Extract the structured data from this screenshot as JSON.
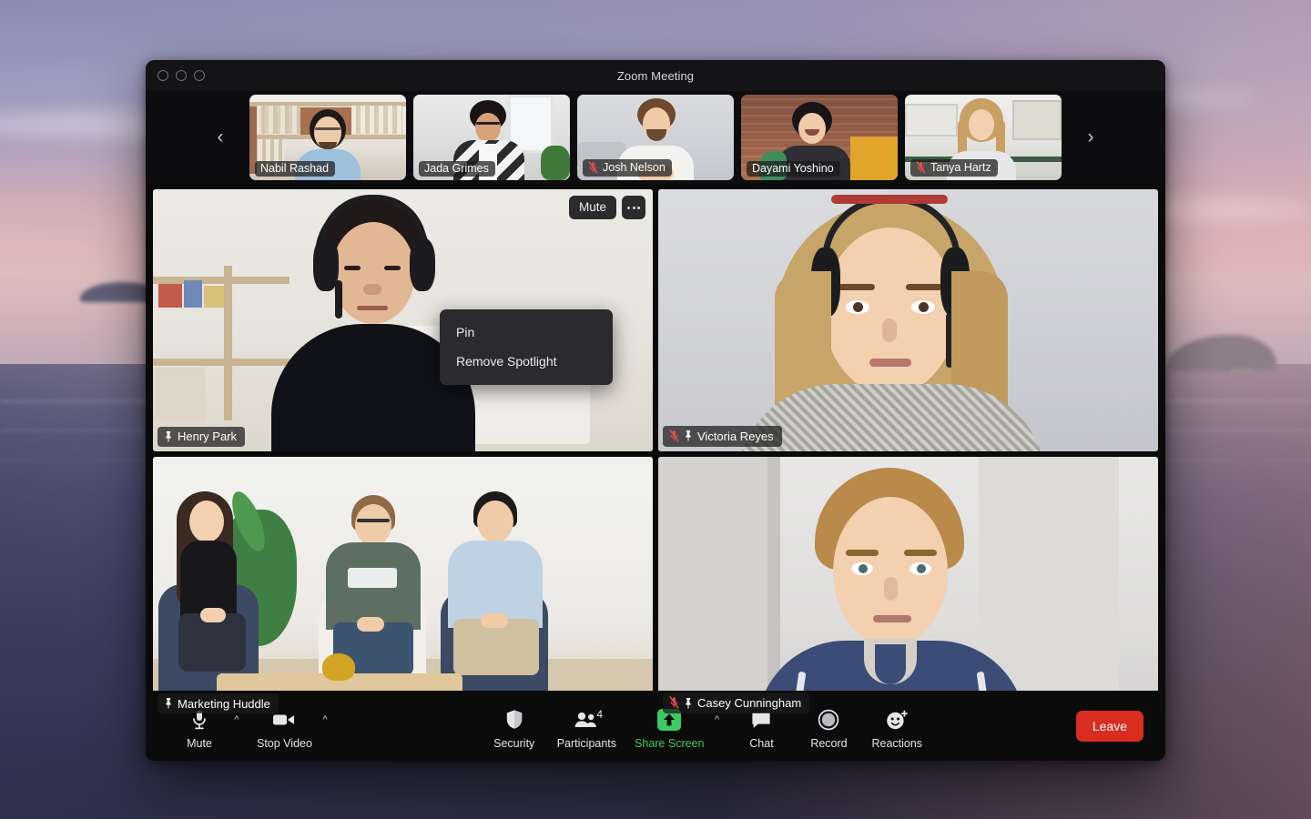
{
  "window": {
    "title": "Zoom Meeting",
    "traffic_lights": [
      "close-button",
      "minimize-button",
      "maximize-button"
    ]
  },
  "filmstrip": {
    "prev_arrow": "‹",
    "next_arrow": "›",
    "participants": [
      {
        "name": "Nabil Rashad",
        "muted": false,
        "scene": "bookshelf"
      },
      {
        "name": "Jada Grimes",
        "muted": false,
        "scene": "window-room"
      },
      {
        "name": "Josh Nelson",
        "muted": true,
        "scene": "plain-room"
      },
      {
        "name": "Dayami Yoshino",
        "muted": false,
        "scene": "brick-room"
      },
      {
        "name": "Tanya Hartz",
        "muted": true,
        "scene": "kitchen"
      }
    ]
  },
  "grid": {
    "tiles": [
      {
        "name": "Henry Park",
        "muted": false,
        "pinned": true,
        "active_speaker": false,
        "scene": "henry",
        "has_controls": true
      },
      {
        "name": "Victoria Reyes",
        "muted": true,
        "pinned": true,
        "active_speaker": false,
        "scene": "victoria",
        "has_controls": false
      },
      {
        "name": "Marketing Huddle",
        "muted": false,
        "pinned": true,
        "active_speaker": true,
        "scene": "huddle",
        "has_controls": false
      },
      {
        "name": "Casey Cunningham",
        "muted": true,
        "pinned": true,
        "active_speaker": false,
        "scene": "casey",
        "has_controls": false
      }
    ]
  },
  "tile_controls": {
    "mute_label": "Mute",
    "more_label": "•••"
  },
  "context_menu": {
    "items": [
      {
        "label": "Pin"
      },
      {
        "label": "Remove Spotlight"
      }
    ]
  },
  "toolbar": {
    "mute": {
      "label": "Mute",
      "icon": "microphone-icon",
      "caret": "^"
    },
    "stop_video": {
      "label": "Stop Video",
      "icon": "camera-icon",
      "caret": "^"
    },
    "security": {
      "label": "Security",
      "icon": "shield-icon"
    },
    "participants": {
      "label": "Participants",
      "icon": "people-icon",
      "count": "4"
    },
    "share_screen": {
      "label": "Share Screen",
      "icon": "share-arrow-icon",
      "caret": "^",
      "accent_color": "#3ec963"
    },
    "chat": {
      "label": "Chat",
      "icon": "speech-bubble-icon"
    },
    "record": {
      "label": "Record",
      "icon": "record-circle-icon"
    },
    "reactions": {
      "label": "Reactions",
      "icon": "smiley-plus-icon"
    },
    "leave": {
      "label": "Leave",
      "color": "#d92d20"
    }
  },
  "colors": {
    "window_background": "#0a0a0a",
    "titlebar": "#141416",
    "toolbar": "#0b0b0c",
    "active_speaker_border": "#3ec963",
    "accent_green": "#3ec963",
    "leave_red": "#d92d20",
    "muted_mic_red": "#e84b4b",
    "name_pill_background": "rgba(26,26,26,0.72)"
  }
}
